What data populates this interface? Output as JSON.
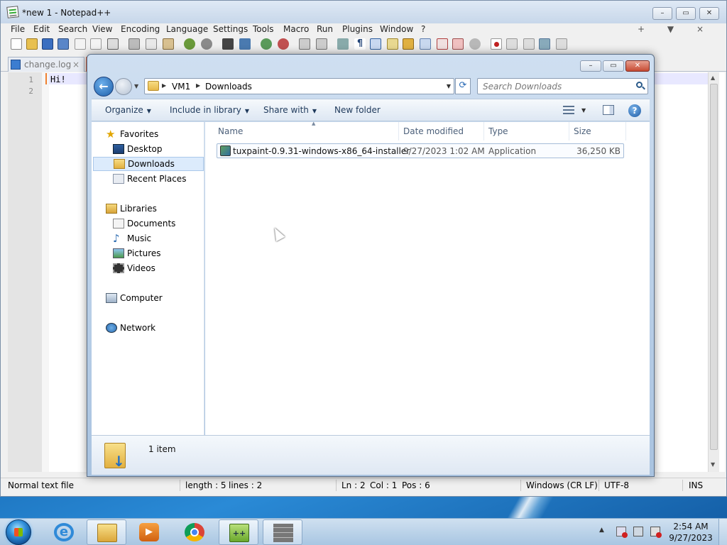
{
  "npp": {
    "title": "*new 1 - Notepad++",
    "menu": [
      "File",
      "Edit",
      "Search",
      "View",
      "Encoding",
      "Language",
      "Settings",
      "Tools",
      "Macro",
      "Run",
      "Plugins",
      "Window",
      "?"
    ],
    "menu_right": "+ ▼ ×",
    "tabs": [
      {
        "label": "change.log",
        "close": "×"
      }
    ],
    "editor": {
      "line_numbers": [
        "1",
        "2"
      ],
      "text": "Hi!"
    },
    "status": {
      "file_type": "Normal text file",
      "length": "length : 5",
      "lines": "lines : 2",
      "ln": "Ln : 2",
      "col": "Col : 1",
      "pos": "Pos : 6",
      "eol": "Windows (CR LF)",
      "encoding": "UTF-8",
      "mode": "INS"
    }
  },
  "explorer": {
    "breadcrumbs": [
      "VM1",
      "Downloads"
    ],
    "search_placeholder": "Search Downloads",
    "toolbar": {
      "organize": "Organize",
      "include_in_library": "Include in library",
      "share_with": "Share with",
      "new_folder": "New folder"
    },
    "nav": {
      "favorites": "Favorites",
      "desktop": "Desktop",
      "downloads": "Downloads",
      "recent_places": "Recent Places",
      "libraries": "Libraries",
      "documents": "Documents",
      "music": "Music",
      "pictures": "Pictures",
      "videos": "Videos",
      "computer": "Computer",
      "network": "Network"
    },
    "columns": {
      "name": "Name",
      "date_modified": "Date modified",
      "type": "Type",
      "size": "Size"
    },
    "files": [
      {
        "name": "tuxpaint-0.9.31-windows-x86_64-installer",
        "date_modified": "9/27/2023 1:02 AM",
        "type": "Application",
        "size": "36,250 KB"
      }
    ],
    "item_count": "1 item"
  },
  "taskbar": {
    "clock_time": "2:54 AM",
    "clock_date": "9/27/2023",
    "apps": [
      "internet-explorer",
      "file-explorer",
      "media-player",
      "chrome",
      "notepad-plus-plus",
      "virtualbox"
    ]
  },
  "colors": {
    "accent": "#1e395b",
    "selection": "#dcebfc",
    "close_red": "#c64a32"
  }
}
